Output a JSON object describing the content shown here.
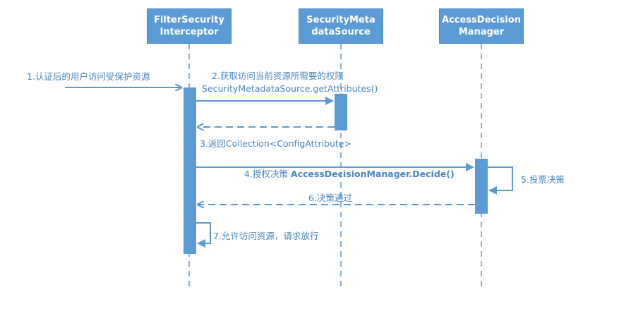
{
  "colors": {
    "accent": "#5b9bd5",
    "line": "#5b9bd5",
    "text": "#4a86c0"
  },
  "participants": [
    {
      "line1": "FilterSecurity",
      "line2": "Interceptor"
    },
    {
      "line1": "SecurityMeta",
      "line2": "dataSource"
    },
    {
      "line1": "AccessDecision",
      "line2": "Manager"
    }
  ],
  "messages": {
    "m1": "1.认证后的用户访问受保护资源",
    "m2_line1": "2.获取访问当前资源所需要的权限",
    "m2_line2": "SecurityMetadataSource.getAttributes()",
    "m3": "3.返回Collection<ConfigAttribute>",
    "m4_prefix": "4.授权决策 ",
    "m4_method": "AccessDecisionManager.Decide()",
    "m5": "5.投票决策",
    "m6": "6.决策通过",
    "m7": "7.允许访问资源，请求放行"
  }
}
